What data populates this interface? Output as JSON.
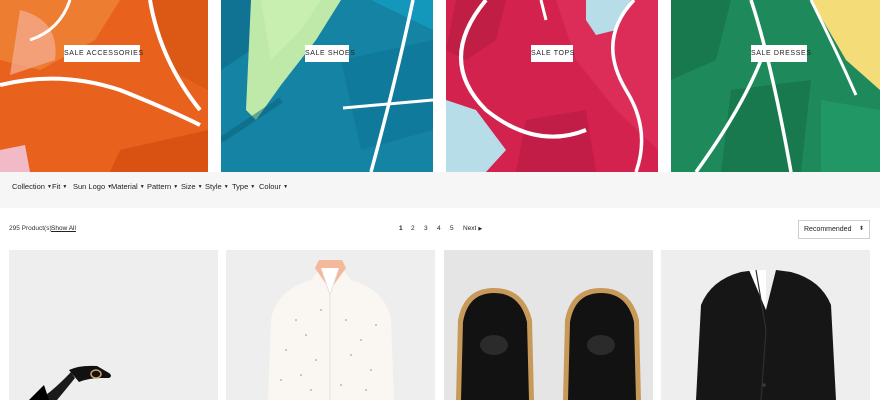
{
  "category_tiles": [
    {
      "label": "SALE ACCESSORIES",
      "color": "#e8621d"
    },
    {
      "label": "SALE SHOES",
      "color": "#1583a3"
    },
    {
      "label": "SALE TOPS",
      "color": "#d2224d"
    },
    {
      "label": "SALE DRESSES",
      "color": "#1e8a5c"
    }
  ],
  "filters": [
    {
      "label": "Collection"
    },
    {
      "label": "Fit"
    },
    {
      "label": "Sun Logo"
    },
    {
      "label": "Material"
    },
    {
      "label": "Pattern"
    },
    {
      "label": "Size"
    },
    {
      "label": "Style"
    },
    {
      "label": "Type"
    },
    {
      "label": "Colour"
    }
  ],
  "results": {
    "count_text": "295 Product(s)",
    "show_all_label": "Show All"
  },
  "pagination": {
    "pages": [
      "1",
      "2",
      "3",
      "4",
      "5"
    ],
    "current": "1",
    "next_label": "Next"
  },
  "sort": {
    "selected": "Recommended"
  },
  "products": [
    {
      "image": "black ankle-strap heeled sandal"
    },
    {
      "image": "white printed shirt"
    },
    {
      "image": "black leather brogue shoes"
    },
    {
      "image": "black tailored blazer"
    }
  ]
}
